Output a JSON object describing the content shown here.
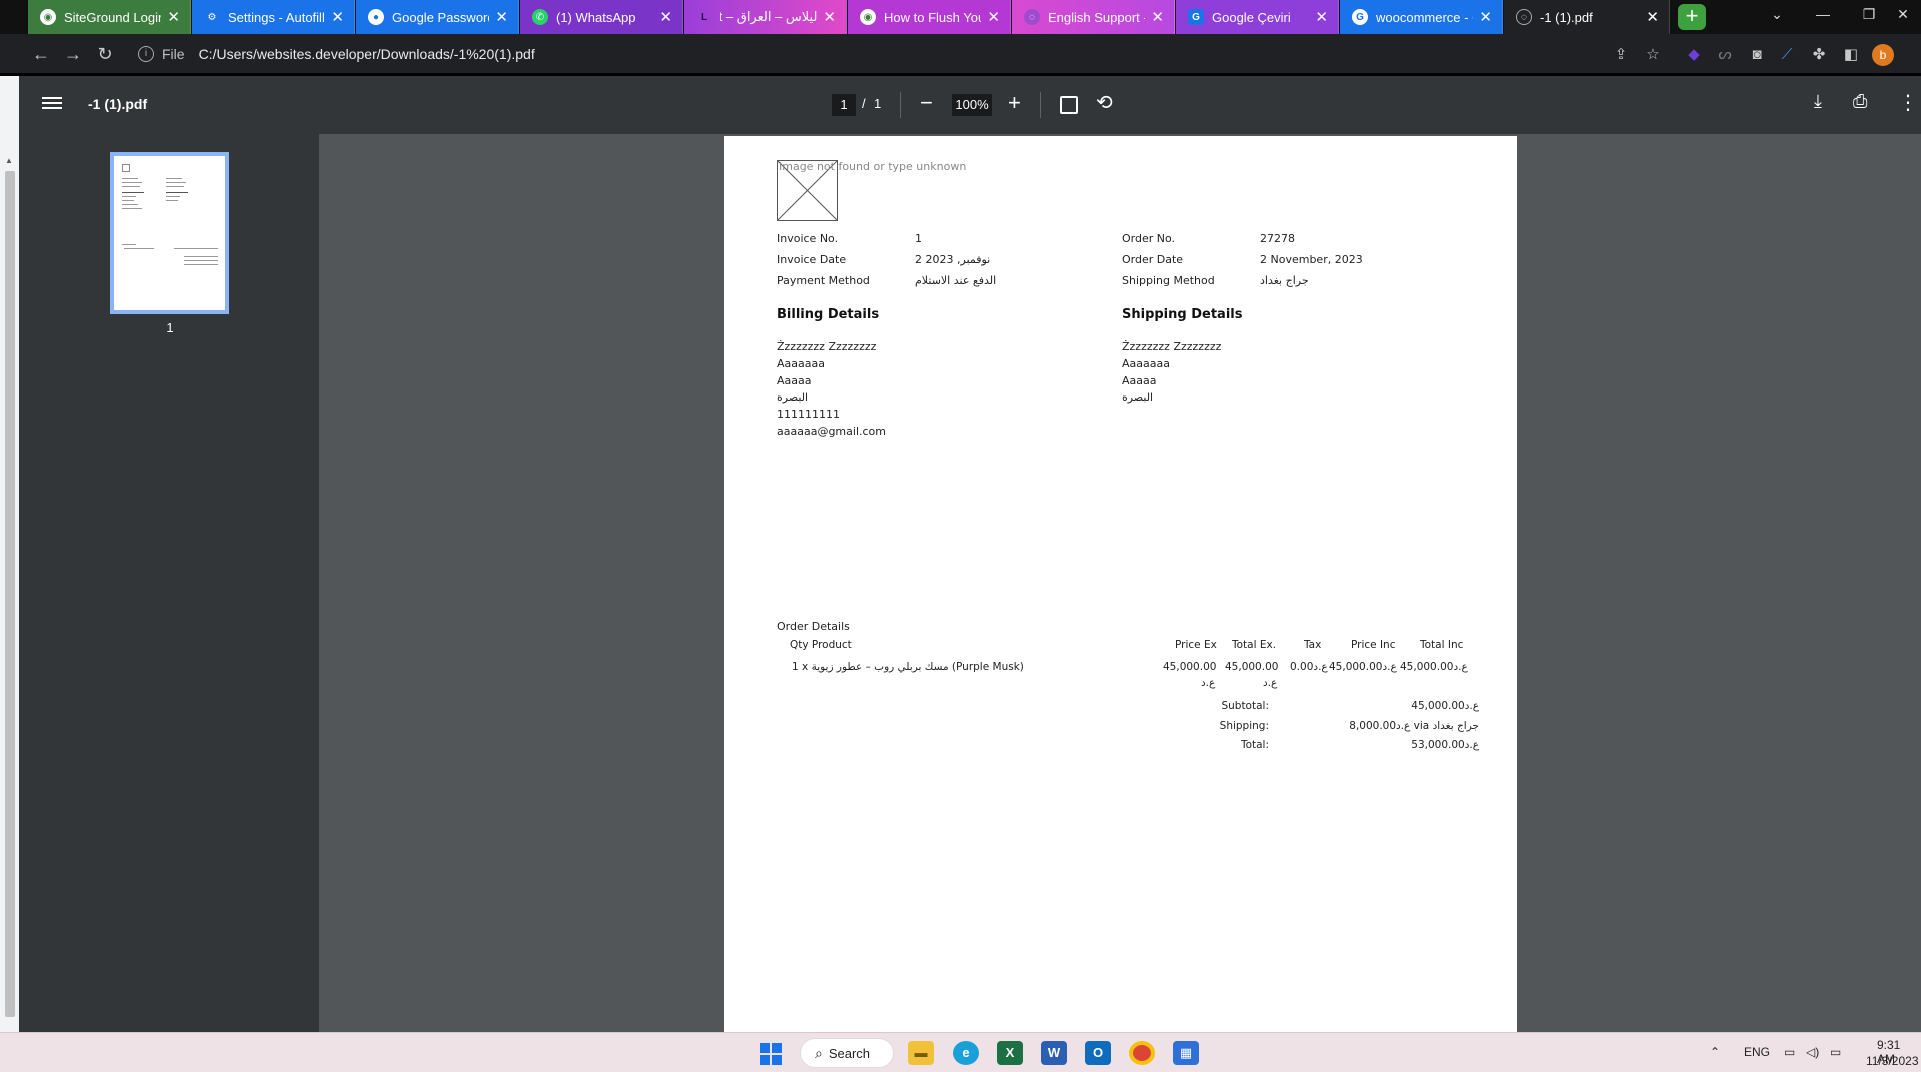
{
  "tabs": [
    {
      "title": "SiteGround Login",
      "favicon": "siteground-icon",
      "color": "#3d7c3f"
    },
    {
      "title": "Settings - Autofill",
      "favicon": "settings-icon",
      "color": "#1a73e8"
    },
    {
      "title": "Google Password",
      "favicon": "google-password-icon",
      "color": "#1a73e8"
    },
    {
      "title": "(1) WhatsApp",
      "favicon": "whatsapp-icon",
      "color": "#25d366"
    },
    {
      "title": "ليلاس – العراق – nt",
      "favicon": "lilas-icon",
      "color": "#8b3fd9"
    },
    {
      "title": "How to Flush Your",
      "favicon": "article-icon",
      "color": "#3d7c3f"
    },
    {
      "title": "English Support -",
      "favicon": "support-icon",
      "color": "#a04ad0"
    },
    {
      "title": "Google Çeviri",
      "favicon": "google-translate-icon",
      "color": "#1a73e8"
    },
    {
      "title": "woocommerce - G",
      "favicon": "google-icon",
      "color": "#1a73e8"
    },
    {
      "title": "-1 (1).pdf",
      "favicon": "pdf-globe-icon",
      "color": "#5f6368"
    }
  ],
  "address_bar": {
    "scheme": "File",
    "url": "C:/Users/websites.developer/Downloads/-1%20(1).pdf"
  },
  "pdf_toolbar": {
    "title": "-1 (1).pdf",
    "current_page": "1",
    "separator": "/",
    "total_pages": "1",
    "zoom": "100%"
  },
  "sidebar": {
    "thumbnail_label": "1"
  },
  "invoice": {
    "image_alt": "Image not found or type unknown",
    "meta_left": [
      {
        "label": "Invoice No.",
        "value": "1"
      },
      {
        "label": "Invoice Date",
        "value": "2 نوفمبر, 2023"
      },
      {
        "label": "Payment Method",
        "value": "الدفع عند الاستلام"
      }
    ],
    "meta_right": [
      {
        "label": "Order No.",
        "value": "27278"
      },
      {
        "label": "Order Date",
        "value": "2 November, 2023"
      },
      {
        "label": "Shipping Method",
        "value": "جراج بغداد"
      }
    ],
    "billing": {
      "heading": "Billing Details",
      "lines": [
        "Żzzzzzzz Zzzzzzzz",
        "Aaaaaaa",
        "Aaaaa",
        "البصرة",
        "111111111",
        "aaaaaa@gmail.com"
      ]
    },
    "shipping": {
      "heading": "Shipping Details",
      "lines": [
        "Żzzzzzzz Zzzzzzzz",
        "Aaaaaaa",
        "Aaaaa",
        "البصرة"
      ]
    },
    "order": {
      "title": "Order Details",
      "headers": {
        "qty_product": "Qty Product",
        "price_ex": "Price Ex",
        "total_ex": "Total Ex.",
        "tax": "Tax",
        "price_inc": "Price Inc",
        "total_inc": "Total Inc"
      },
      "row": {
        "qty_product": "1 x مسك بربلي روب – عطور زيوية (Purple Musk)",
        "price_ex_1": "45,000.00",
        "price_ex_2": "ع.د",
        "total_ex_1": "45,000.00",
        "total_ex_2": "ع.د",
        "tax": "0.00ع.د",
        "price_inc": "45,000.00ع.د",
        "total_inc": "45,000.00ع.د"
      },
      "totals": [
        {
          "label": "Subtotal:",
          "value": "45,000.00ع.د"
        },
        {
          "label": "Shipping:",
          "value": "8,000.00ع.د via جراج بغداد"
        },
        {
          "label": "Total:",
          "value": "53,000.00ع.د"
        }
      ]
    }
  },
  "taskbar": {
    "search_label": "Search",
    "language": "ENG",
    "time": "9:31 AM",
    "date": "11/3/2023"
  }
}
